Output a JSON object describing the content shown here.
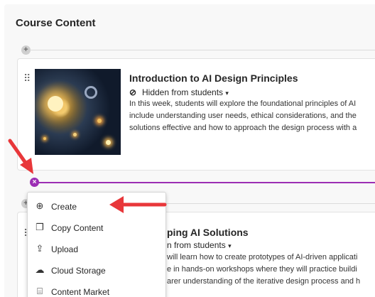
{
  "page": {
    "title": "Course Content"
  },
  "items": [
    {
      "title": "Introduction to AI Design Principles",
      "visibility": "Hidden from students",
      "description": [
        "In this week, students will explore the foundational principles of AI",
        "include understanding user needs, ethical considerations, and the",
        "solutions effective and how to approach the design process with a"
      ]
    },
    {
      "title": "ping AI Solutions",
      "visibility": "n from students",
      "description": [
        "will learn how to create prototypes of AI-driven applicati",
        "e in hands-on workshops where they will practice buildi",
        "arer understanding of the iterative design process and h"
      ]
    }
  ],
  "menu": [
    {
      "label": "Create",
      "icon": "plus-circle-icon"
    },
    {
      "label": "Copy Content",
      "icon": "copy-icon"
    },
    {
      "label": "Upload",
      "icon": "upload-icon"
    },
    {
      "label": "Cloud Storage",
      "icon": "cloud-icon"
    },
    {
      "label": "Content Market",
      "icon": "market-icon"
    }
  ],
  "colors": {
    "accent": "#9c2eb4",
    "arrow": "#e8373a"
  }
}
